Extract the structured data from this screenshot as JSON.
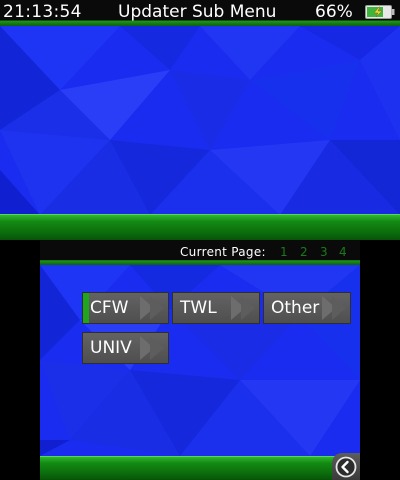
{
  "status_bar": {
    "time": "21:13:54",
    "title": "Updater Sub Menu",
    "battery_percent": "66%",
    "battery_icon": "battery-charging-icon"
  },
  "bottom": {
    "page_label": "Current Page:",
    "pages": [
      "1",
      "2",
      "3",
      "4"
    ],
    "current_page": "1"
  },
  "menu": {
    "items": [
      {
        "label": "CFW",
        "selected": true
      },
      {
        "label": "TWL",
        "selected": false
      },
      {
        "label": "Other",
        "selected": false
      },
      {
        "label": "UNIV",
        "selected": false
      }
    ]
  },
  "footer": {
    "back_icon": "back-arrow-icon"
  },
  "colors": {
    "background_blue": "#1a2cf0",
    "bar_green": "#138a13",
    "bar_black": "#0a0a0a",
    "button_gray": "#575757",
    "page_number_green": "#1a7a1a"
  }
}
